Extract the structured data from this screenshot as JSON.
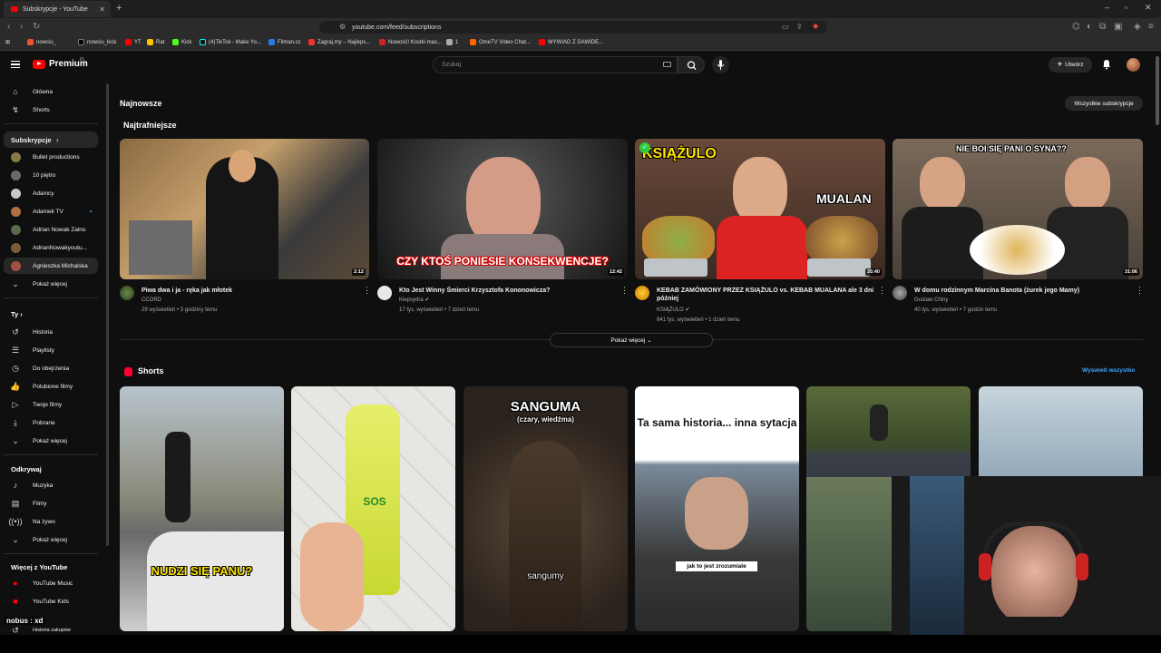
{
  "browser": {
    "tab_title": "Subskrypcje - YouTube",
    "url": "youtube.com/feed/subscriptions",
    "bookmarks": [
      "nowciu_",
      "nowciu_kick",
      "YT",
      "Rat",
      "Kick",
      "(4)TikTok - Make Yo...",
      "Filman.cc",
      "Zagraj.my – Najleps...",
      "Nowość! Kostki mas...",
      "1",
      "OmeTV Video Chat...",
      "WYWIAD Z DAWIDE..."
    ]
  },
  "header": {
    "logo_text": "Premium",
    "logo_region": "PL",
    "search_placeholder": "Szukaj",
    "create_label": "Utwórz"
  },
  "sidebar": {
    "top": [
      {
        "label": "Główna",
        "icon": "home-icon"
      },
      {
        "label": "Shorts",
        "icon": "shorts-icon"
      }
    ],
    "subs_heading": "Subskrypcje",
    "subs": [
      {
        "label": "Bullet productions",
        "color": "#8a7a4a"
      },
      {
        "label": "10 piętro",
        "color": "#6a6a6a"
      },
      {
        "label": "Adamcy",
        "color": "#c9c9c9"
      },
      {
        "label": "Adamek TV",
        "color": "#b07040"
      },
      {
        "label": "Adrian Nowak Żalno",
        "color": "#5a6a4a"
      },
      {
        "label": "AdrianNowakyoutu...",
        "color": "#7a5a3a"
      },
      {
        "label": "Agnieszka Michalska",
        "color": "#a05040"
      }
    ],
    "subs_more": "Pokaż więcej",
    "you_heading": "Ty",
    "you": [
      {
        "label": "Historia",
        "icon": "history-icon"
      },
      {
        "label": "Playlisty",
        "icon": "playlist-icon"
      },
      {
        "label": "Do obejrzenia",
        "icon": "clock-icon"
      },
      {
        "label": "Polubione filmy",
        "icon": "like-icon"
      },
      {
        "label": "Twoje filmy",
        "icon": "video-icon"
      },
      {
        "label": "Pobrane",
        "icon": "download-icon"
      },
      {
        "label": "Pokaż więcej",
        "icon": "chevron-down-icon"
      }
    ],
    "explore_heading": "Odkrywaj",
    "explore": [
      {
        "label": "Muzyka",
        "icon": "music-icon"
      },
      {
        "label": "Filmy",
        "icon": "film-icon"
      },
      {
        "label": "Na żywo",
        "icon": "live-icon"
      },
      {
        "label": "Pokaż więcej",
        "icon": "chevron-down-icon"
      }
    ],
    "more_heading": "Więcej z YouTube",
    "more": [
      {
        "label": "YouTube Music",
        "icon": "yt-music-icon"
      },
      {
        "label": "YouTube Kids",
        "icon": "yt-kids-icon"
      },
      {
        "label": "Historia zakupów",
        "icon": "history-icon"
      }
    ]
  },
  "main": {
    "latest_heading": "Najnowsze",
    "all_subs_button": "Wszystkie subskrypcje",
    "trending_heading": "Najtrafniejsze",
    "videos": [
      {
        "title": "Piwa dwa i ja - ręka jak młotek",
        "channel": "CCORD",
        "meta": "29 wyświetleń • 3 godziny temu",
        "duration": "2:12",
        "overlay": ""
      },
      {
        "title": "Kto Jest Winny Śmierci Krzysztofa Kononowicza?",
        "channel": "Klepsydra",
        "meta": "17 tys. wyświetleń • 7 dzień temu",
        "duration": "12:42",
        "overlay": "CZY KTOŚ PONIESIE KONSEKWENCJE?"
      },
      {
        "title": "KEBAB ZAMÓWIONY PRZEZ KSIĄŻULO vs. KEBAB MUALANA ale 3 dni później",
        "channel": "KSIĄŻULO",
        "meta": "841 tys. wyświetleń • 1 dzień temu",
        "duration": "35:40",
        "overlay": "KSIĄŻULO|MUALAN"
      },
      {
        "title": "W domu rodzinnym Marcina Banota (żurek jego Mamy)",
        "channel": "Gustaw Chiny",
        "meta": "40 tys. wyświetleń • 7 godzin temu",
        "duration": "31:06",
        "overlay": "NIE BOI SIĘ PANI O SYNA??"
      }
    ],
    "show_more": "Pokaż więcej",
    "shorts_heading": "Shorts",
    "shorts_view_all": "Wyświetl wszystko",
    "shorts": [
      {
        "overlay": "NUDZI SIĘ PANU?"
      },
      {
        "overlay": "SOS"
      },
      {
        "overlay": "SANGUMA",
        "overlay2": "(czary, wiedźma)",
        "overlay3": "sangumy"
      },
      {
        "overlay": "Ta sama historia... inna sytacja",
        "overlay2": "jak to jest zrozumiale"
      },
      {
        "overlay": ""
      },
      {
        "overlay": ""
      }
    ]
  },
  "chat": {
    "line": "nobus : xd"
  },
  "colors": {
    "brand_red": "#ff0000",
    "accent_blue": "#3ea6ff",
    "bg": "#0f0f0f"
  }
}
